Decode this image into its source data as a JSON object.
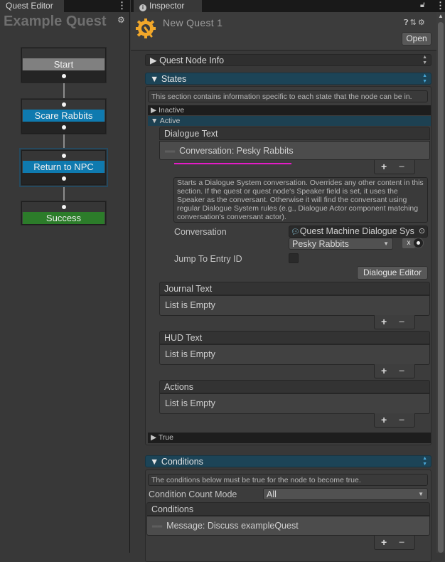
{
  "quest_editor": {
    "tab_label": "Quest Editor",
    "title": "Example Quest",
    "nodes": [
      {
        "label": "Start",
        "color": "#808080"
      },
      {
        "label": "Scare Rabbits",
        "color": "#0f7aaf"
      },
      {
        "label": "Return to NPC",
        "color": "#0f7aaf",
        "selected": true
      },
      {
        "label": "Success",
        "color": "#2c7c2a"
      }
    ]
  },
  "inspector": {
    "tab_label": "Inspector",
    "tab_icon": "info-icon",
    "object_name": "New Quest 1",
    "header_icons": [
      "help-icon",
      "presets-icon",
      "gear-icon"
    ],
    "open_button": "Open",
    "quest_node_info": "Quest Node Info",
    "states": {
      "label": "States",
      "help": "This section contains information specific to each state that the node can be in.",
      "inactive_label": "Inactive",
      "active_label": "Active",
      "true_label": "True",
      "dialogue_text": {
        "header": "Dialogue Text",
        "items": [
          "Conversation: Pesky Rabbits"
        ],
        "help": "Starts a Dialogue System conversation. Overrides any other content in this section. If the quest or quest node's Speaker field is set, it uses the Speaker as the conversant. Otherwise it will find the conversant using regular Dialogue System rules (e.g., Dialogue Actor component matching conversation's conversant actor).",
        "conversation_label": "Conversation",
        "conversation_database": "Quest Machine Dialogue Sys",
        "conversation_value": "Pesky Rabbits",
        "clear_button": "x",
        "jump_label": "Jump To Entry ID",
        "jump_checked": false,
        "dialogue_editor_button": "Dialogue Editor"
      },
      "journal_text": {
        "header": "Journal Text",
        "empty": "List is Empty"
      },
      "hud_text": {
        "header": "HUD Text",
        "empty": "List is Empty"
      },
      "actions": {
        "header": "Actions",
        "empty": "List is Empty"
      }
    },
    "conditions": {
      "label": "Conditions",
      "help": "The conditions below must be true for the node to become true.",
      "count_mode_label": "Condition Count Mode",
      "count_mode_value": "All",
      "list_header": "Conditions",
      "items": [
        "Message: Discuss exampleQuest"
      ]
    },
    "list_buttons": {
      "add": "+",
      "remove": "−"
    }
  }
}
